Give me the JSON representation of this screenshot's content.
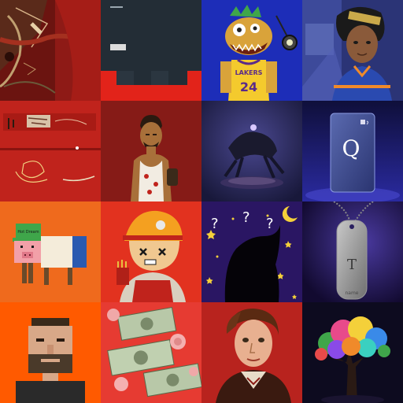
{
  "gallery": {
    "tiles": [
      {
        "id": "abstract-red-painting",
        "bg": "#8e1a16"
      },
      {
        "id": "pixel-phone-screen",
        "bg": "#1f2a33"
      },
      {
        "id": "monster-lakers-jersey",
        "bg": "#1d2db8"
      },
      {
        "id": "anime-girl-portrait",
        "bg": "#2b3476"
      },
      {
        "id": "red-abstract-collage",
        "bg": "#c0231c"
      },
      {
        "id": "man-tank-top-portrait",
        "bg": "#861b17"
      },
      {
        "id": "dark-creature-3d",
        "bg": "#24244a"
      },
      {
        "id": "purple-card",
        "bg": "#1d1d6e"
      },
      {
        "id": "pig-cow-creature",
        "bg": "#ef6a1d"
      },
      {
        "id": "ninja-girl-pixel",
        "bg": "#e2321f"
      },
      {
        "id": "night-silhouette",
        "bg": "#2a1663"
      },
      {
        "id": "dog-tag-galaxy",
        "bg": "#1a1240"
      },
      {
        "id": "pixel-man-portrait",
        "bg": "#ff5a00"
      },
      {
        "id": "money-roses",
        "bg": "#e63b32"
      },
      {
        "id": "man-oil-portrait",
        "bg": "#b8231e"
      },
      {
        "id": "rainbow-tree",
        "bg": "#0d0b1f"
      }
    ]
  },
  "texts": {
    "jersey_team": "LAKERS",
    "jersey_number": "24",
    "card_letter": "Q",
    "pig_cap_text": "Hot Dream",
    "tag_letter": "T",
    "tag_small": "name"
  }
}
